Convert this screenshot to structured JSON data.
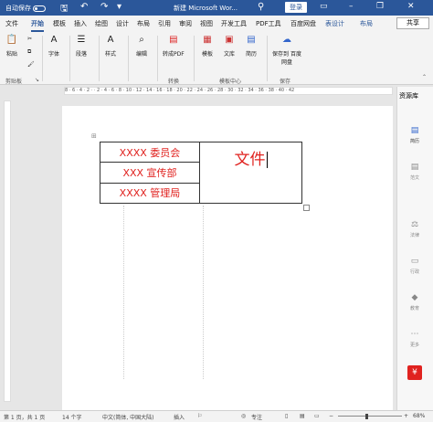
{
  "titlebar": {
    "autosave": "自动保存",
    "autosave_state": "off",
    "doc_title": "新建 Microsoft Wor...",
    "login": "登录",
    "window_controls": [
      "minimize-icon",
      "restore-icon",
      "close-icon"
    ]
  },
  "menu": {
    "tabs": [
      "文件",
      "开始",
      "模板",
      "插入",
      "绘图",
      "设计",
      "布局",
      "引用",
      "审阅",
      "视图",
      "开发工具",
      "PDF工具",
      "百度网盘",
      "表设计",
      "布局"
    ],
    "active": "开始",
    "share": "共享"
  },
  "ribbon": {
    "paste": "粘贴",
    "font": "字体",
    "paragraph": "段落",
    "styles": "样式",
    "editing": "编辑",
    "convert_pdf": "转成PDF",
    "template": "模板",
    "library": "文库",
    "resume": "简历",
    "save_to_baidu": "保存到 百度网盘",
    "group_clipboard": "剪贴板",
    "group_convert": "转换",
    "group_template_center": "模板中心",
    "group_save": "保存"
  },
  "ruler": {
    "ticks": "8 · 6 · 4 · 2 · · 2 · 4 · 6 · 8 · 10 · 12 · 14 · 16 · 18 · 20 · 22 · 24 · 26 · 28 · 30 · 32 · 34 · 36 · 38 · 40 · 42"
  },
  "document": {
    "table": {
      "rows": [
        "XXXX 委员会",
        "XXX 宣传部",
        "XXXX 管理局"
      ],
      "right_cell": "文件"
    }
  },
  "side_pane": {
    "title": "资源库",
    "items": [
      "简历",
      "范文",
      "法律",
      "行政",
      "教育",
      "更多"
    ]
  },
  "statusbar": {
    "page": "第 1 页，共 1 页",
    "words": "14 个字",
    "language": "中文(简体, 中国大陆)",
    "insert": "插入",
    "focus": "专注",
    "zoom": "68%"
  },
  "colors": {
    "title_bar": "#2b579a",
    "table_text": "#e0221f"
  }
}
